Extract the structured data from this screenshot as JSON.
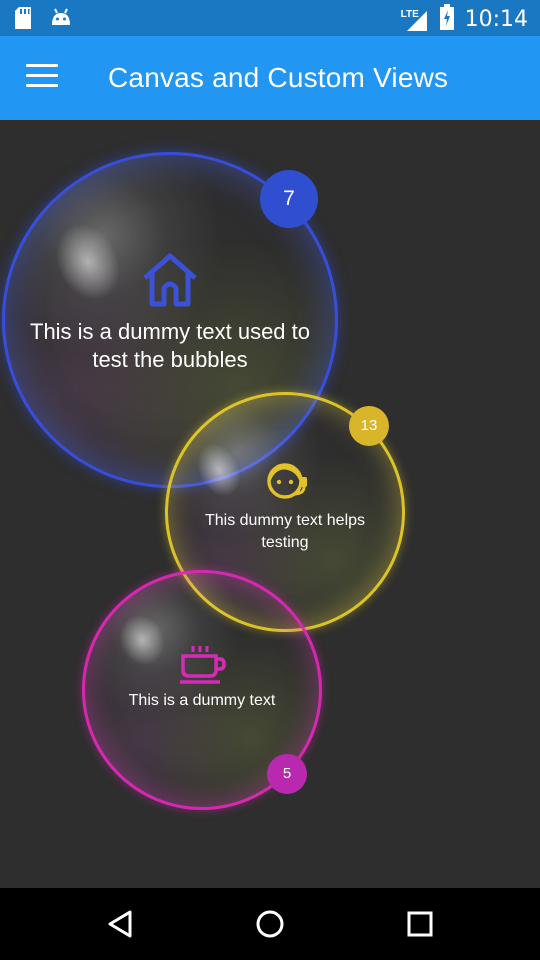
{
  "status_bar": {
    "time": "10:14",
    "network_label": "LTE",
    "icons": [
      "sd-card-icon",
      "android-icon",
      "signal-icon",
      "battery-icon"
    ]
  },
  "app_bar": {
    "title": "Canvas and Custom Views",
    "menu_icon": "hamburger-menu-icon",
    "color": "#2196f3"
  },
  "bubbles": [
    {
      "icon": "home-icon",
      "text_line1": "This is a dummy text used to",
      "text_line2": "test the bubbles",
      "badge": "7",
      "color": "#3b52d8"
    },
    {
      "icon": "headset-support-icon",
      "text_line1": "This dummy text helps",
      "text_line2": "testing",
      "badge": "13",
      "color": "#e2c12c"
    },
    {
      "icon": "coffee-cup-icon",
      "text_line1": "This is a dummy text",
      "text_line2": "",
      "badge": "5",
      "color": "#d62bb6"
    }
  ],
  "nav_bar": {
    "buttons": [
      "back-icon",
      "home-circle-icon",
      "recents-icon"
    ]
  }
}
